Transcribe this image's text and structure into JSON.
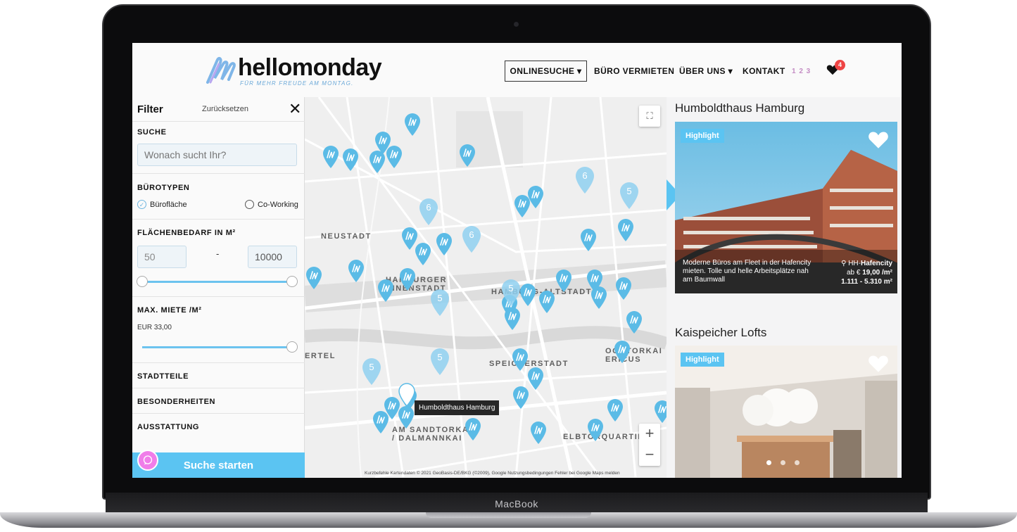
{
  "device": {
    "label": "MacBook"
  },
  "header": {
    "logo_text": "hellomonday",
    "logo_tagline": "FÜR MEHR FREUDE AM MONTAG.",
    "nav": {
      "online": "ONLINESUCHE ▾",
      "buero": "BÜRO VERMIETEN",
      "ueber": "ÜBER UNS ▾",
      "kontakt": "KONTAKT",
      "lang": "1 2 3"
    },
    "favorites_count": "4"
  },
  "filter": {
    "title": "Filter",
    "reset": "Zurücksetzen",
    "close": "✕",
    "suche_label": "SUCHE",
    "search_placeholder": "Wonach sucht Ihr?",
    "buerotypen_label": "BÜROTYPEN",
    "buerotypen": [
      {
        "label": "Bürofläche",
        "checked": true
      },
      {
        "label": "Co-Working",
        "checked": false
      }
    ],
    "flaeche_label": "FLÄCHENBEDARF IN M²",
    "flaeche_min": "50",
    "flaeche_max": "10000",
    "dash": "-",
    "miete_label": "MAX. MIETE /M²",
    "miete_value": "EUR 33,00",
    "miete_fraction": 1.0,
    "sections": [
      "STADTTEILE",
      "BESONDERHEITEN",
      "AUSSTATTUNG"
    ],
    "cta": "Suche starten"
  },
  "map": {
    "areas": {
      "neustadt": "NEUSTADT",
      "innenstadt": "HAMBURGER\nINNENSTADT",
      "altstadt": "HAMBURG-ALTSTADT",
      "speicherstadt": "SPEICHERSTADT",
      "sandtorkai": "AM SANDTORKAI\n/ DALMANNKAI",
      "elbtorquartier": "ELBTORQUARTIER",
      "ooktorkai": "OOKTORKAI\nERICUS",
      "ertel": "ERTEL"
    },
    "tooltip": "Humboldthaus Hamburg",
    "zoom_in": "+",
    "zoom_out": "−",
    "attribution": "Kurzbefehle   Kartendaten © 2021 GeoBasis-DE/BKG (©2009), Google   Nutzungsbedingungen   Fehler bei Google Maps melden",
    "clusters": [
      "6",
      "6",
      "6",
      "5",
      "5",
      "5",
      "5",
      "5"
    ]
  },
  "listings": [
    {
      "title": "Humboldthaus Hamburg",
      "badge": "Highlight",
      "description": "Moderne Büros am Fleet in der Hafencity mieten. Tolle und helle Arbeitsplätze nah am Baumwall",
      "location_prefix": "HH-",
      "location": "Hafencity",
      "price_prefix": "ab € ",
      "price": "19,00 /m²",
      "size": "1.111 - 5.310 m²"
    },
    {
      "title": "Kaispeicher Lofts",
      "badge": "Highlight",
      "image_index": 0,
      "image_count": 3
    }
  ],
  "colors": {
    "accent": "#5bc4f2",
    "pin": "#5bbbe6",
    "chat": "#f07de9",
    "badge": "#e44444"
  }
}
